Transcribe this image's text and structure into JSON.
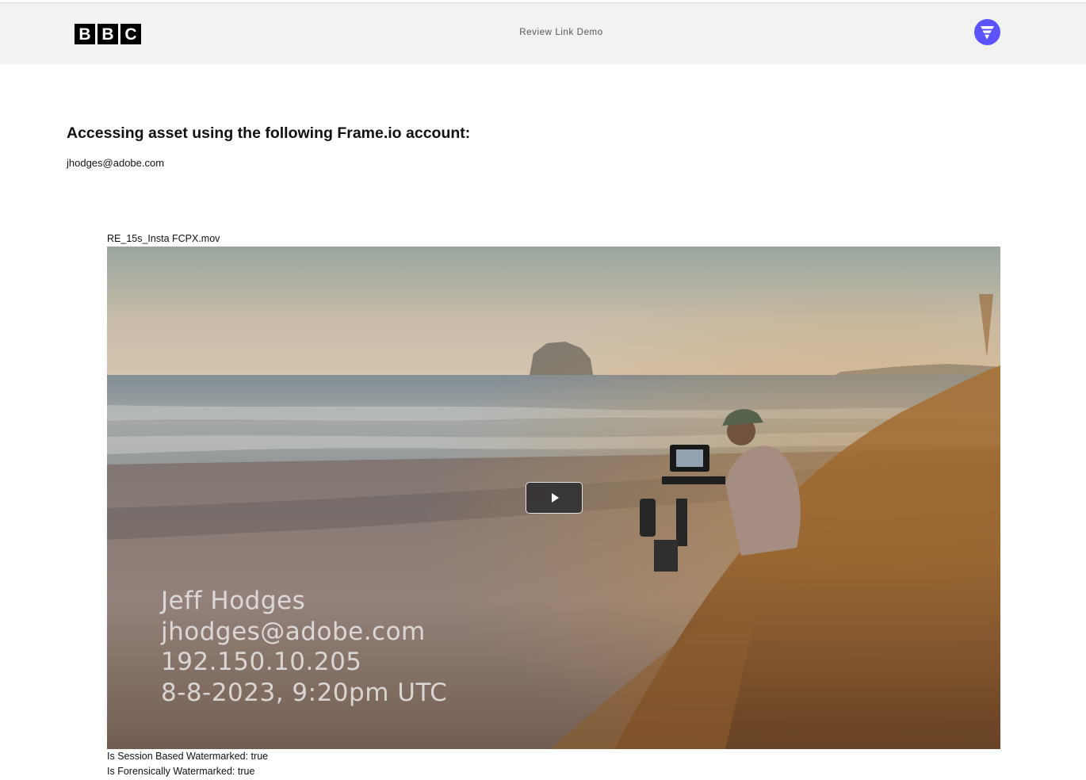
{
  "header": {
    "logo_text": "BBC",
    "logo_letters": [
      "B",
      "B",
      "C"
    ],
    "title": "Review Link Demo",
    "app_icon": "frameio-logo-icon",
    "app_icon_color": "#5b53ff"
  },
  "main": {
    "heading": "Accessing asset using the following Frame.io account:",
    "account_email": "jhodges@adobe.com"
  },
  "asset": {
    "filename": "RE_15s_Insta FCPX.mov",
    "play_icon": "play-icon",
    "watermark_lines": [
      "Jeff Hodges",
      "jhodges@adobe.com",
      "192.150.10.205",
      "8-8-2023, 9:20pm UTC"
    ]
  },
  "flags": {
    "session_watermarked": "Is Session Based Watermarked: true",
    "forensic_watermarked": "Is Forensically Watermarked: true"
  }
}
